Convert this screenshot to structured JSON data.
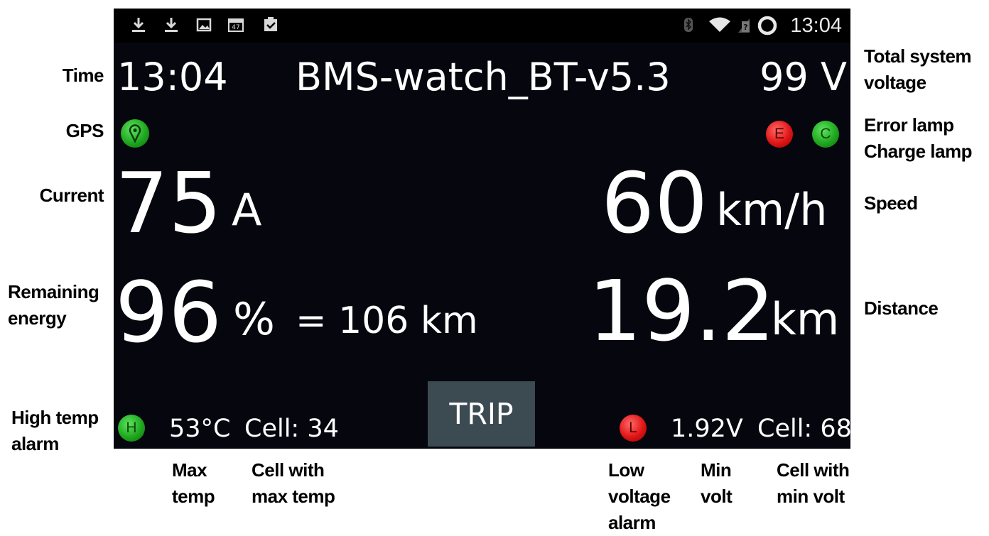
{
  "status_bar": {
    "time": "13:04",
    "left_icons": [
      "download-icon",
      "download-icon",
      "image-icon",
      "calendar-icon",
      "clipboard-check-icon"
    ],
    "calendar_badge": "47",
    "right_icons": [
      "bluetooth-icon",
      "wifi-icon",
      "no-sim-icon",
      "sync-circle-icon"
    ]
  },
  "header": {
    "time": "13:04",
    "app_title": "BMS-watch_BT-v5.3",
    "voltage": "99 V"
  },
  "lamps": {
    "gps": {
      "color": "#1fa81f"
    },
    "error": {
      "letter": "E",
      "color": "#e01515"
    },
    "charge": {
      "letter": "C",
      "color": "#1fa81f"
    },
    "high_temp": {
      "letter": "H",
      "color": "#1fa81f"
    },
    "low_voltage": {
      "letter": "L",
      "color": "#e01515"
    }
  },
  "readings": {
    "current_value": "75",
    "current_unit": "A",
    "speed_value": "60",
    "speed_unit": "km/h",
    "energy_value": "96",
    "energy_unit": "%",
    "range": "= 106 km",
    "distance_value": "19.2",
    "distance_unit": "km"
  },
  "bottom": {
    "max_temp": "53°C",
    "max_temp_cell": "Cell: 34",
    "trip_label": "TRIP",
    "min_volt": "1.92V",
    "min_volt_cell": "Cell: 68"
  },
  "annotations": {
    "time": "Time",
    "gps": "GPS",
    "current": "Current",
    "remaining_energy": [
      "Remaining",
      "energy"
    ],
    "high_temp_alarm": [
      "High temp",
      "alarm"
    ],
    "total_system_voltage": [
      "Total system",
      "voltage"
    ],
    "error_lamp": "Error lamp",
    "charge_lamp": "Charge lamp",
    "speed": "Speed",
    "distance": "Distance",
    "max_temp": [
      "Max",
      "temp"
    ],
    "cell_with_max_temp": [
      "Cell with",
      "max temp"
    ],
    "low_voltage_alarm": [
      "Low",
      "voltage",
      "alarm"
    ],
    "min_volt": [
      "Min",
      "volt"
    ],
    "cell_with_min_volt": [
      "Cell with",
      "min volt"
    ]
  }
}
